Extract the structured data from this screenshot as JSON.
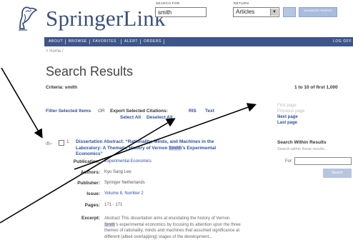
{
  "header": {
    "brand": "SpringerLink",
    "search_for_label": "SEARCH FOR",
    "search_value": "smith",
    "return_label": "RETURN",
    "return_value": "Articles",
    "go_label": "GO",
    "advanced_label": "ADVANCED SEARCH"
  },
  "nav": {
    "items": [
      "ABOUT",
      "BROWSE",
      "FAVORITES",
      "ALERT",
      "ORDERS"
    ],
    "log_off": "LOG OFF"
  },
  "breadcrumb": "> Home /",
  "results": {
    "title": "Search Results",
    "criteria": "Criteria: smith",
    "count": "1 to 10 of first 1,000"
  },
  "actions": {
    "filter_label": "Filter Selected Items",
    "or": "OR",
    "export_label": "Export Selected Citations:",
    "export_ris": "RIS",
    "export_text": "Text",
    "select_all": "Select All",
    "deselect_all": "Deselect All"
  },
  "pager": {
    "first": "First page",
    "previous": "Previous page",
    "next": "Next page",
    "last": "Last page"
  },
  "within": {
    "heading": "Search Within Results",
    "sub": "Search within these results...",
    "for_label": "For:",
    "search_label": "Search"
  },
  "item": {
    "number": "1",
    "title_part1": "Dissertation Abstract: “Rationality, Minds, and Machines in the Laboratory: A Thematic History of Vernon ",
    "title_highlight": "Smith",
    "title_part2": "’s Experimental Economics”",
    "labels": {
      "publication": "Publication:",
      "authors": "Authors:",
      "publisher": "Publisher:",
      "issue": "Issue:",
      "pages": "Pages:",
      "excerpt": "Excerpt:"
    },
    "publication": "Experimental Economics",
    "authors": "Kyu Sang Lee",
    "publisher": "Springer Netherlands",
    "issue": "Volume 8, Number 2",
    "pages": "171 - 171",
    "excerpt_part1": "Abstract This dissertation aims at elucidating the history of Vernon ",
    "excerpt_highlight": "Smith",
    "excerpt_part2": "’s experimental economics by focusing its attention upon the three themes of rationality, minds and machines that assumed significance at different (albeit overlapping) stages of the development..."
  },
  "colors": {
    "brand": "#3c4f7a",
    "nav_bg": "#3e558a",
    "link": "#2d4fa0",
    "highlight": "#d3dbea"
  }
}
